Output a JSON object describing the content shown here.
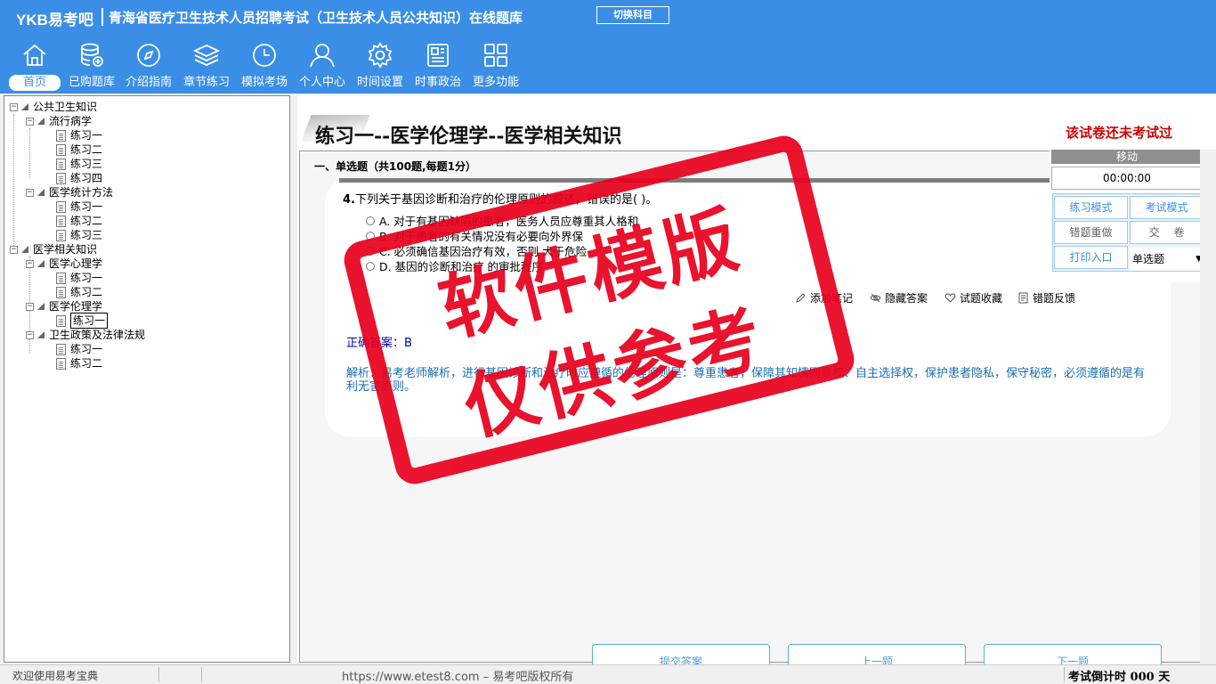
{
  "header": {
    "logo": "YKB易考吧",
    "title": "青海省医疗卫生技术人员招聘考试（卫生技术人员公共知识）在线题库",
    "switch_label": "切换科目"
  },
  "nav": [
    {
      "label": "首页",
      "icon": "home-icon"
    },
    {
      "label": "已购题库",
      "icon": "database-icon"
    },
    {
      "label": "介绍指南",
      "icon": "compass-icon"
    },
    {
      "label": "章节练习",
      "icon": "layers-icon"
    },
    {
      "label": "模拟考场",
      "icon": "clock-icon"
    },
    {
      "label": "个人中心",
      "icon": "user-icon"
    },
    {
      "label": "时间设置",
      "icon": "gear-icon"
    },
    {
      "label": "时事政治",
      "icon": "newspaper-icon"
    },
    {
      "label": "更多功能",
      "icon": "grid-icon"
    }
  ],
  "tree": {
    "root1": "公共卫生知识",
    "epi": "流行病学",
    "epi_items": [
      "练习一",
      "练习二",
      "练习三",
      "练习四"
    ],
    "stat": "医学统计方法",
    "stat_items": [
      "练习一",
      "练习二",
      "练习三"
    ],
    "root2": "医学相关知识",
    "psy": "医学心理学",
    "psy_items": [
      "练习一",
      "练习二"
    ],
    "eth": "医学伦理学",
    "eth_items": [
      "练习一"
    ],
    "law": "卫生政策及法律法规",
    "law_items": [
      "练习一",
      "练习二"
    ]
  },
  "paper": {
    "title": "练习一--医学伦理学--医学相关知识",
    "status": "该试卷还未考试过",
    "section": "一、单选题（共100题,每题1分）"
  },
  "question": {
    "number": "4.",
    "text": "下列关于基因诊断和治疗的伦理原则的叙述，错误的是(  )。",
    "options": [
      "A. 对于有基因缺陷的患者，医务人员应尊重其人格和",
      "B. 对于患者的有关情况没有必要向外界保",
      "C. 必须确信基因治疗有效，否则        大于危险",
      "D. 基因的诊断和治疗         的审批程序"
    ],
    "tools": [
      "添加笔记",
      "隐藏答案",
      "试题收藏",
      "错题反馈"
    ],
    "answer_label": "正确答案：B",
    "analysis": "解析：易考老师解析，进行基因诊断和治疗时应遵循的伦理原则是：尊重患者，保障其知情同意权、自主选择权，保护患者隐私，保守秘密，必须遵循的是有利无害原则。"
  },
  "bottom_buttons": {
    "submit": "提交答案",
    "prev": "上一题",
    "next": "下一题"
  },
  "control": {
    "move": "移动",
    "timer": "00:00:00",
    "practice_mode": "练习模式",
    "exam_mode": "考试模式",
    "redo_wrong": "错题重做",
    "submit_paper": "交　 卷",
    "print": "打印入口",
    "type_select": "单选题"
  },
  "stamp": {
    "line1": "软件模版",
    "line2": "仅供参考"
  },
  "statusbar": {
    "welcome": "欢迎使用易考宝典",
    "url": "https://www.etest8.com – 易考吧版权所有",
    "countdown": "考试倒计时 000 天"
  },
  "colors": {
    "header": "#3a8ee6",
    "stamp": "#e8001c",
    "status_red": "#d00000"
  }
}
